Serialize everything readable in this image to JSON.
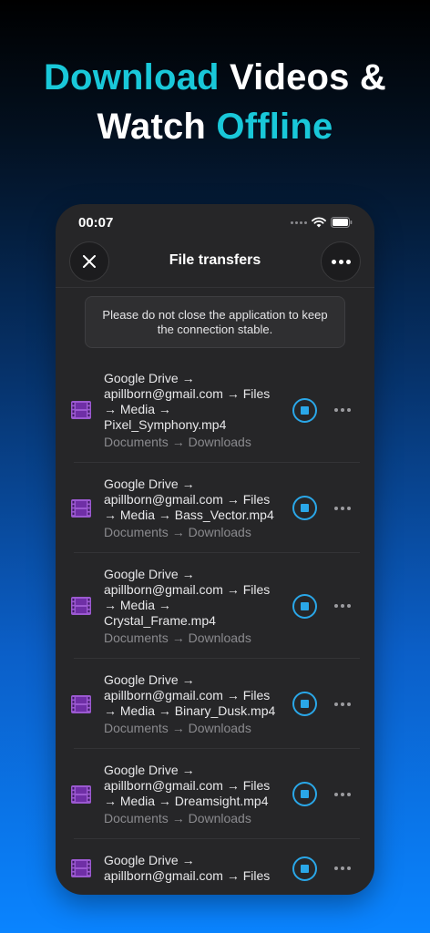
{
  "marketing": {
    "line1_accent": "Download",
    "line1_rest": " Videos &",
    "line2_start": "Watch ",
    "line2_accent": "Offline"
  },
  "status_bar": {
    "time": "00:07"
  },
  "nav": {
    "title": "File transfers",
    "close_icon": "close-icon",
    "more_icon": "more-icon"
  },
  "banner": {
    "text": "Please do not close the application to keep the connection stable."
  },
  "colors": {
    "accent": "#19c8d9",
    "stop": "#2aa7e8",
    "film": "#9b59d0",
    "panel": "#262628"
  },
  "transfers": [
    {
      "path": "Google Drive → apillborn@gmail.com → Files → Media → Pixel_Symphony.mp4",
      "route": "Documents → Downloads"
    },
    {
      "path": "Google Drive → apillborn@gmail.com → Files → Media → Bass_Vector.mp4",
      "route": "Documents → Downloads"
    },
    {
      "path": "Google Drive → apillborn@gmail.com → Files → Media → Crystal_Frame.mp4",
      "route": "Documents → Downloads"
    },
    {
      "path": "Google Drive → apillborn@gmail.com → Files → Media → Binary_Dusk.mp4",
      "route": "Documents → Downloads"
    },
    {
      "path": "Google Drive → apillborn@gmail.com → Files → Media → Dreamsight.mp4",
      "route": "Documents → Downloads"
    },
    {
      "path": "Google Drive → apillborn@gmail.com → Files",
      "route": ""
    }
  ]
}
